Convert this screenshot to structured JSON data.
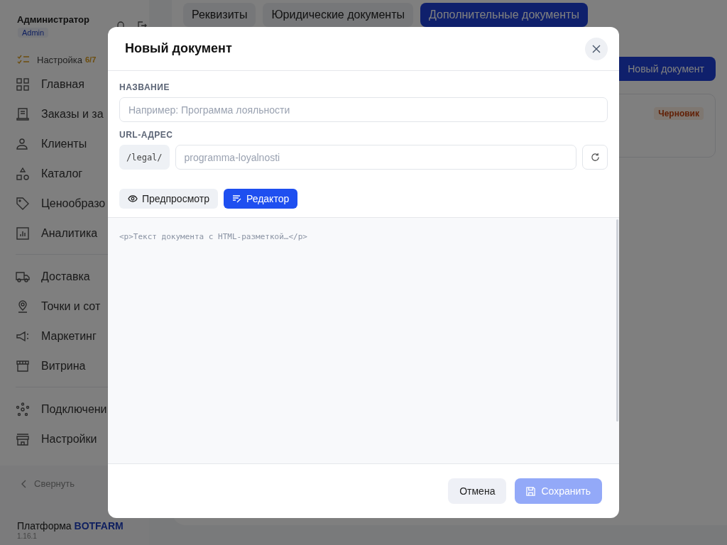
{
  "sidebar": {
    "user_name": "Администратор",
    "role_badge": "Admin",
    "setup": {
      "label": "Настройка",
      "count": "6/7"
    },
    "groups": [
      [
        {
          "label": "Главная"
        },
        {
          "label": "Заказы и за"
        },
        {
          "label": "Клиенты"
        },
        {
          "label": "Каталог"
        },
        {
          "label": "Ценообразо"
        },
        {
          "label": "Аналитика"
        }
      ],
      [
        {
          "label": "Доставка"
        },
        {
          "label": "Точки и сот"
        },
        {
          "label": "Маркетинг"
        },
        {
          "label": "Витрина"
        }
      ],
      [
        {
          "label": "Подключени"
        },
        {
          "label": "Настройки"
        }
      ]
    ],
    "collapse": "Свернуть",
    "platform_label": "Платформа",
    "brand": "BOTFARM",
    "version": "1.16.1"
  },
  "tabs": [
    {
      "label": "Реквизиты",
      "selected": false
    },
    {
      "label": "Юридические документы",
      "selected": false
    },
    {
      "label": "Дополнительные документы",
      "selected": true
    }
  ],
  "new_document_button": "Новый документ",
  "document_card": {
    "status": "Черновик"
  },
  "modal": {
    "title": "Новый документ",
    "name_label": "НАЗВАНИЕ",
    "name_placeholder": "Например: Программа лояльности",
    "url_label": "URL-АДРЕС",
    "url_prefix": "/legal/",
    "url_placeholder": "programma-loyalnosti",
    "modes": [
      {
        "label": "Предпросмотр",
        "selected": false
      },
      {
        "label": "Редактор",
        "selected": true
      }
    ],
    "editor_placeholder": "<p>Текст документа с HTML-разметкой…</p>",
    "cancel": "Отмена",
    "save": {
      "label": "Сохранить",
      "disabled": true
    }
  }
}
